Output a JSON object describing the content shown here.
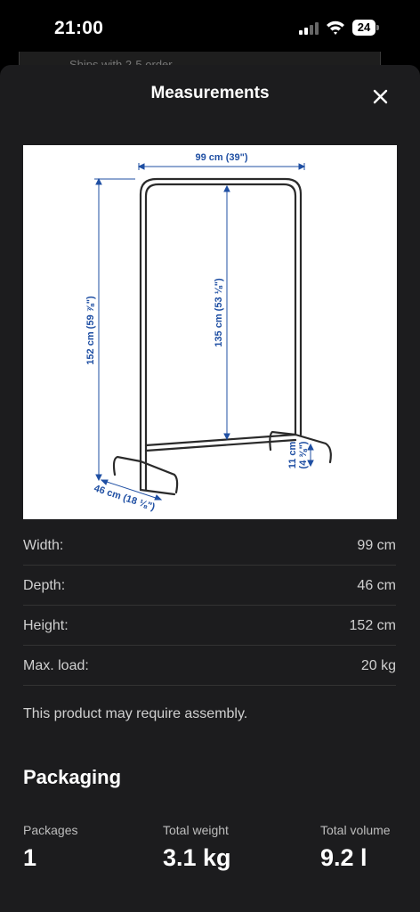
{
  "status_bar": {
    "time": "21:00",
    "battery": "24"
  },
  "background": {
    "snippet": "Ships with 2-5 order"
  },
  "modal": {
    "title": "Measurements"
  },
  "diagram": {
    "width_label": "99 cm (39\")",
    "height_label": "152 cm (59 ⅞\")",
    "inner_height_label": "135 cm (53 ⅛\")",
    "depth_label": "46 cm (18 ⅛\")",
    "foot_label_cm": "11 cm",
    "foot_label_in": "(4 ⅜\")"
  },
  "specs": [
    {
      "label": "Width:",
      "value": "99 cm"
    },
    {
      "label": "Depth:",
      "value": "46 cm"
    },
    {
      "label": "Height:",
      "value": "152 cm"
    },
    {
      "label": "Max. load:",
      "value": "20 kg"
    }
  ],
  "assembly_note": "This product may require assembly.",
  "packaging": {
    "heading": "Packaging",
    "columns": [
      {
        "label": "Packages",
        "value": "1"
      },
      {
        "label": "Total weight",
        "value": "3.1 kg"
      },
      {
        "label": "Total volume",
        "value": "9.2 l"
      }
    ]
  },
  "colors": {
    "accent_blue": "#1f4fa3",
    "sheet_bg": "#1c1c1e"
  }
}
